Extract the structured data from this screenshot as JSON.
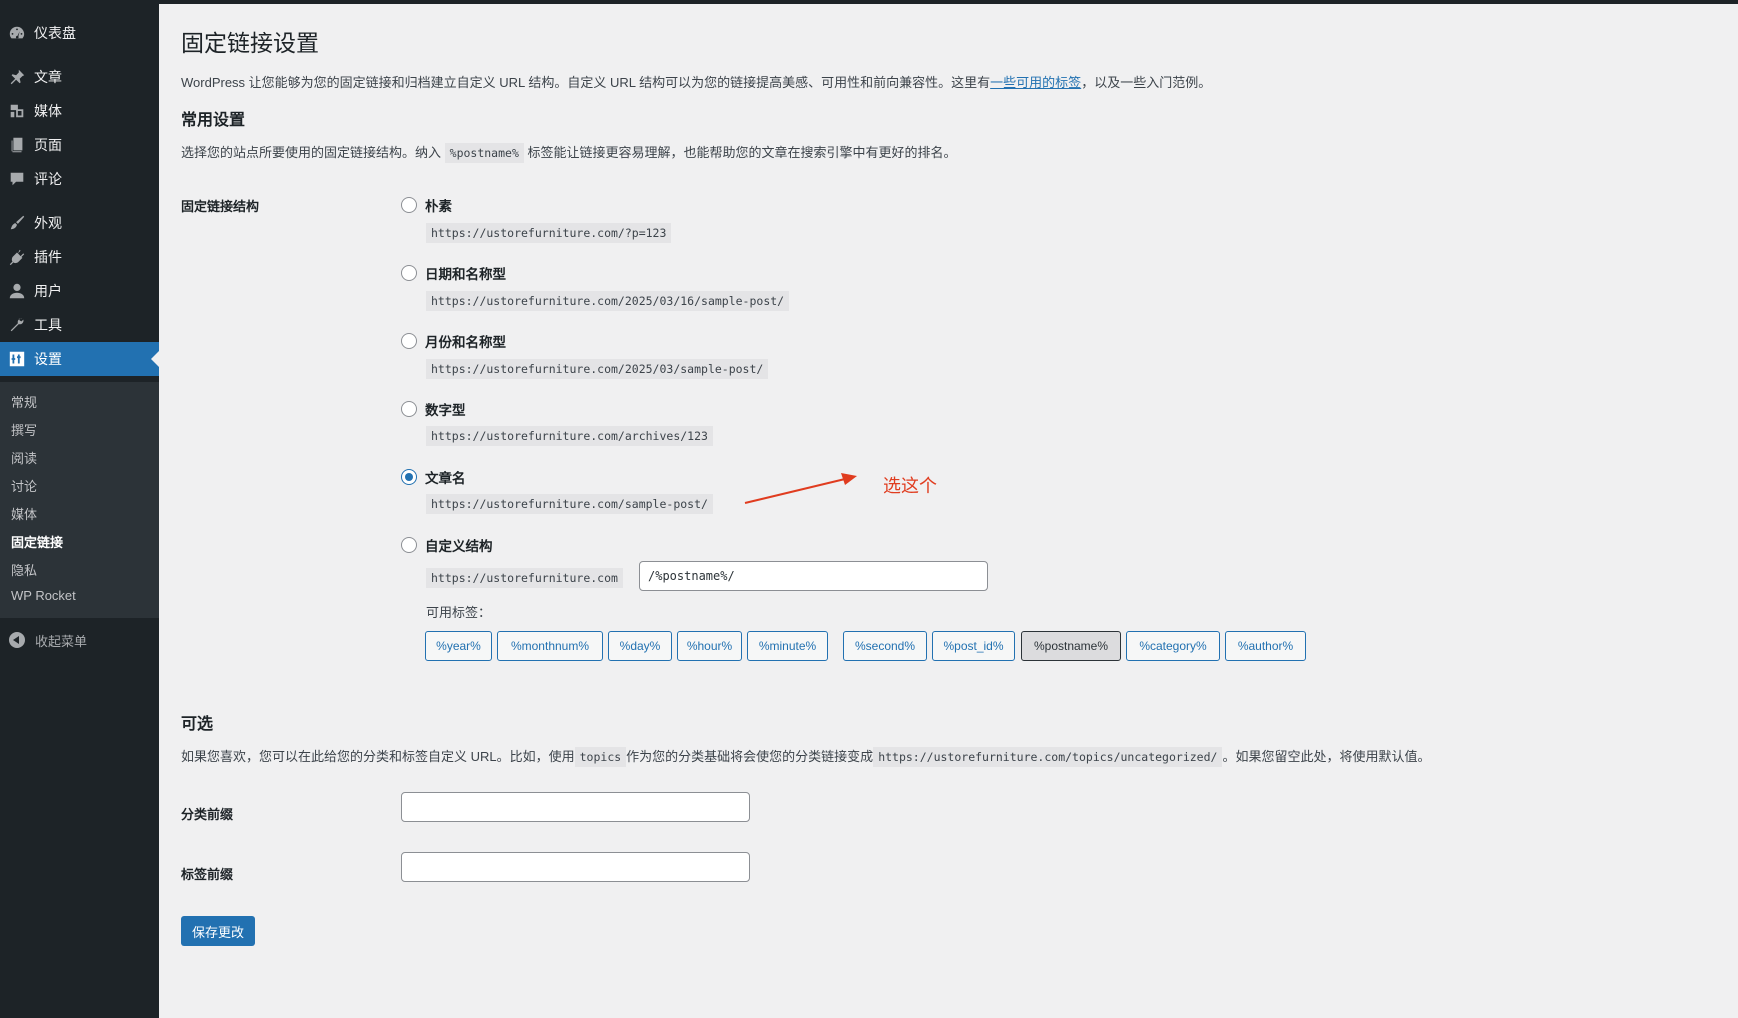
{
  "sidebar": {
    "items": [
      {
        "label": "仪表盘",
        "icon": "dashboard-icon"
      },
      {
        "label": "文章",
        "icon": "pin-icon"
      },
      {
        "label": "媒体",
        "icon": "media-icon"
      },
      {
        "label": "页面",
        "icon": "page-icon"
      },
      {
        "label": "评论",
        "icon": "comment-icon"
      },
      {
        "label": "外观",
        "icon": "brush-icon"
      },
      {
        "label": "插件",
        "icon": "plugin-icon"
      },
      {
        "label": "用户",
        "icon": "user-icon"
      },
      {
        "label": "工具",
        "icon": "wrench-icon"
      },
      {
        "label": "设置",
        "icon": "settings-icon"
      }
    ],
    "submenu": [
      "常规",
      "撰写",
      "阅读",
      "讨论",
      "媒体",
      "固定链接",
      "隐私",
      "WP Rocket"
    ],
    "collapse_label": "收起菜单"
  },
  "page": {
    "title": "固定链接设置",
    "intro_before": "WordPress 让您能够为您的固定链接和归档建立自定义 URL 结构。自定义 URL 结构可以为您的链接提高美感、可用性和前向兼容性。这里有",
    "intro_link": "一些可用的标签",
    "intro_after": "，以及一些入门范例。"
  },
  "common": {
    "heading": "常用设置",
    "desc_before": "选择您的站点所要使用的固定链接结构。纳入",
    "desc_code": "%postname%",
    "desc_after": "标签能让链接更容易理解，也能帮助您的文章在搜索引擎中有更好的排名。",
    "field_label": "固定链接结构",
    "options": [
      {
        "label": "朴素",
        "url": "https://ustorefurniture.com/?p=123",
        "checked": false
      },
      {
        "label": "日期和名称型",
        "url": "https://ustorefurniture.com/2025/03/16/sample-post/",
        "checked": false
      },
      {
        "label": "月份和名称型",
        "url": "https://ustorefurniture.com/2025/03/sample-post/",
        "checked": false
      },
      {
        "label": "数字型",
        "url": "https://ustorefurniture.com/archives/123",
        "checked": false
      },
      {
        "label": "文章名",
        "url": "https://ustorefurniture.com/sample-post/",
        "checked": true
      },
      {
        "label": "自定义结构",
        "url": "https://ustorefurniture.com",
        "checked": false
      }
    ],
    "custom_value": "/%postname%/",
    "tags_label": "可用标签：",
    "tags": [
      "%year%",
      "%monthnum%",
      "%day%",
      "%hour%",
      "%minute%",
      "%second%",
      "%post_id%",
      "%postname%",
      "%category%",
      "%author%"
    ],
    "active_tag": "%postname%"
  },
  "annotation": {
    "text": "选这个",
    "color": "#e03c1f"
  },
  "optional": {
    "heading": "可选",
    "desc_before": "如果您喜欢，您可以在此给您的分类和标签自定义 URL。比如，使用",
    "desc_code1": "topics",
    "desc_mid": "作为您的分类基础将会使您的分类链接变成",
    "desc_code2": "https://ustorefurniture.com/topics/uncategorized/",
    "desc_after": "。如果您留空此处，将使用默认值。",
    "category_label": "分类前缀",
    "category_value": "",
    "tag_label": "标签前缀",
    "tag_value": ""
  },
  "save_label": "保存更改",
  "colors": {
    "accent": "#2271b1",
    "sidebar": "#1d2327",
    "annotation": "#e03c1f"
  }
}
